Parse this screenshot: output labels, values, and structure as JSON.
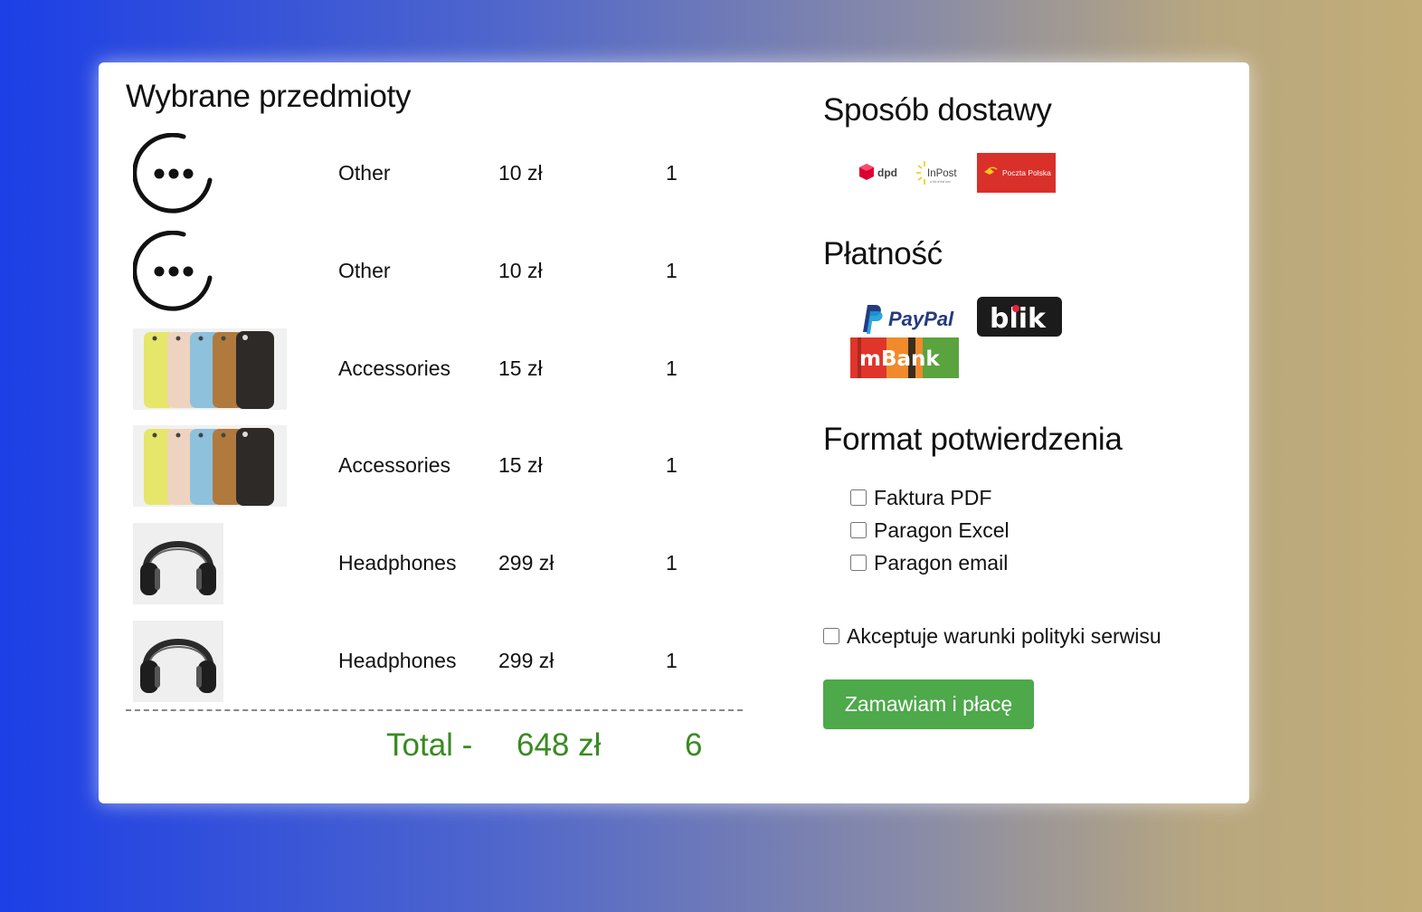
{
  "cart": {
    "title": "Wybrane przedmioty",
    "items": [
      {
        "name": "Other",
        "price": "10 zł",
        "qty": "1",
        "image": "more-icon"
      },
      {
        "name": "Other",
        "price": "10 zł",
        "qty": "1",
        "image": "more-icon"
      },
      {
        "name": "Accessories",
        "price": "15 zł",
        "qty": "1",
        "image": "phone-cases-image"
      },
      {
        "name": "Accessories",
        "price": "15 zł",
        "qty": "1",
        "image": "phone-cases-image"
      },
      {
        "name": "Headphones",
        "price": "299 zł",
        "qty": "1",
        "image": "headphones-image"
      },
      {
        "name": "Headphones",
        "price": "299 zł",
        "qty": "1",
        "image": "headphones-image"
      }
    ],
    "total_label": "Total -",
    "total_price": "648 zł",
    "total_qty": "6"
  },
  "delivery": {
    "title": "Sposób dostawy",
    "options": [
      "dpd",
      "InPost",
      "Poczta Polska"
    ],
    "inpost_tagline": "a bit of the box"
  },
  "payment": {
    "title": "Płatność",
    "options": [
      "PayPal",
      "blik",
      "mBank"
    ]
  },
  "confirmation": {
    "title": "Format potwierdzenia",
    "options": [
      "Faktura PDF",
      "Paragon Excel",
      "Paragon email"
    ]
  },
  "terms_label": "Akceptuje warunki polityki serwisu",
  "submit_label": "Zamawiam i płacę",
  "colors": {
    "total": "#3a8a22",
    "button": "#4da94a",
    "poczta": "#d9302a",
    "mbank_red": "#e0352b",
    "mbank_orange": "#f08a2c",
    "mbank_green": "#5aa33e"
  }
}
